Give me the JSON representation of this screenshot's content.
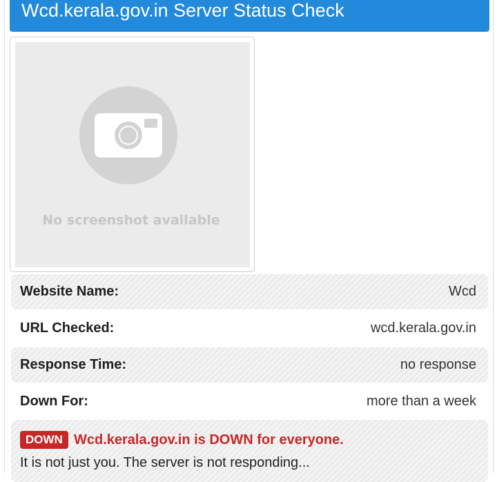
{
  "header": {
    "title": "Wcd.kerala.gov.in Server Status Check"
  },
  "screenshot": {
    "placeholder_text": "No screenshot available",
    "icon": "camera-icon"
  },
  "details": {
    "rows": [
      {
        "label": "Website Name:",
        "value": "Wcd"
      },
      {
        "label": "URL Checked:",
        "value": "wcd.kerala.gov.in"
      },
      {
        "label": "Response Time:",
        "value": "no response"
      },
      {
        "label": "Down For:",
        "value": "more than a week"
      }
    ]
  },
  "status": {
    "badge": "DOWN",
    "headline": "Wcd.kerala.gov.in is DOWN for everyone.",
    "message": "It is not just you. The server is not responding...",
    "color": "#c62828"
  },
  "colors": {
    "header_bg": "#2389da",
    "down_red": "#c62828"
  }
}
